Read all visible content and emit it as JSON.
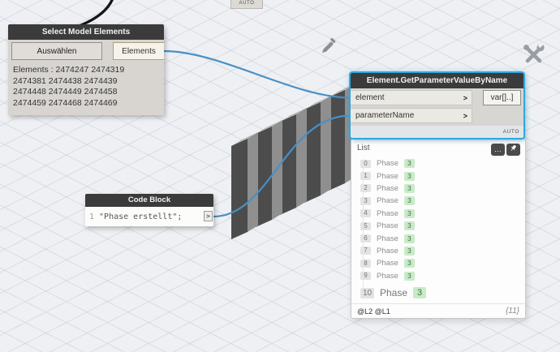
{
  "canvas": {
    "top_node_lacing": "AUTO"
  },
  "select_node": {
    "title": "Select Model Elements",
    "button_label": "Auswählen",
    "output_port": "Elements",
    "info_lines": [
      "Elements : 2474247 2474319",
      "2474381 2474438 2474439",
      "2474448 2474449 2474458",
      "2474459 2474468 2474469"
    ]
  },
  "getparam_node": {
    "title": "Element.GetParameterValueByName",
    "inputs": [
      "element",
      "parameterName"
    ],
    "output_label": "var[]..]",
    "lacing": "AUTO"
  },
  "code_block": {
    "title": "Code Block",
    "line_number": "1",
    "code": "\"Phase erstellt\";"
  },
  "preview": {
    "header": "List",
    "more_label": "…",
    "rows": [
      {
        "index": "0",
        "value": "Phase",
        "badge": "3"
      },
      {
        "index": "1",
        "value": "Phase",
        "badge": "3"
      },
      {
        "index": "2",
        "value": "Phase",
        "badge": "3"
      },
      {
        "index": "3",
        "value": "Phase",
        "badge": "3"
      },
      {
        "index": "4",
        "value": "Phase",
        "badge": "3"
      },
      {
        "index": "5",
        "value": "Phase",
        "badge": "3"
      },
      {
        "index": "6",
        "value": "Phase",
        "badge": "3"
      },
      {
        "index": "7",
        "value": "Phase",
        "badge": "3"
      },
      {
        "index": "8",
        "value": "Phase",
        "badge": "3"
      },
      {
        "index": "9",
        "value": "Phase",
        "badge": "3"
      },
      {
        "index": "10",
        "value": "Phase",
        "badge": "3"
      }
    ],
    "levels": "@L2 @L1",
    "count": "{11}"
  },
  "colors": {
    "wire_blue": "#4a8fc4",
    "selection": "#2fa8e1",
    "badge_green_bg": "#cbe9cb",
    "badge_green_text": "#2e7d32"
  }
}
